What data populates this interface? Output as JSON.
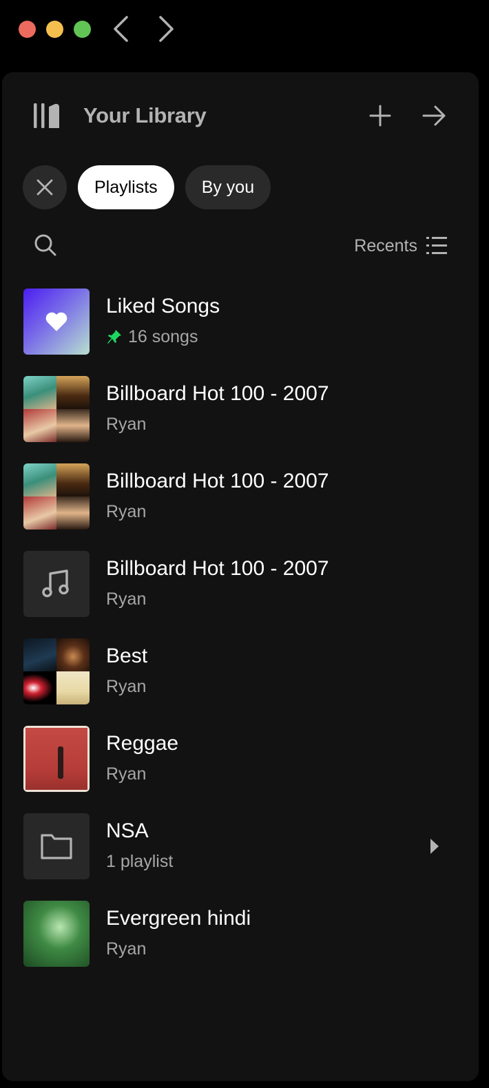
{
  "window": {
    "controls": [
      "close",
      "minimize",
      "zoom"
    ],
    "nav": {
      "back_icon": "chevron-left-icon",
      "forward_icon": "chevron-right-icon"
    }
  },
  "library": {
    "title": "Your Library",
    "icon": "library-icon",
    "create_icon": "plus-icon",
    "expand_icon": "arrow-right-icon"
  },
  "filters": {
    "clear_icon": "close-icon",
    "chips": [
      {
        "label": "Playlists",
        "selected": true
      },
      {
        "label": "By you",
        "selected": false
      }
    ]
  },
  "toolbar": {
    "search_icon": "search-icon",
    "sort_label": "Recents",
    "sort_icon": "list-icon"
  },
  "items": [
    {
      "title": "Liked Songs",
      "subtitle": "16 songs",
      "pinned": true,
      "art": "liked-songs-heart"
    },
    {
      "title": "Billboard Hot 100 - 2007",
      "subtitle": "Ryan",
      "art": "mosaic"
    },
    {
      "title": "Billboard Hot 100 - 2007",
      "subtitle": "Ryan",
      "art": "mosaic"
    },
    {
      "title": "Billboard Hot 100 - 2007",
      "subtitle": "Ryan",
      "art": "music-note-placeholder"
    },
    {
      "title": "Best",
      "subtitle": "Ryan",
      "art": "mosaic"
    },
    {
      "title": "Reggae",
      "subtitle": "Ryan",
      "art": "cover"
    },
    {
      "title": "NSA",
      "subtitle": "1 playlist",
      "art": "folder-placeholder",
      "expandable": true
    },
    {
      "title": "Evergreen hindi",
      "subtitle": "Ryan",
      "art": "cover"
    }
  ],
  "colors": {
    "background": "#000000",
    "panel": "#121212",
    "chip_inactive": "#2a2a2a",
    "chip_active": "#ffffff",
    "pin_green": "#1ed760",
    "secondary_text": "#a7a7a7"
  }
}
